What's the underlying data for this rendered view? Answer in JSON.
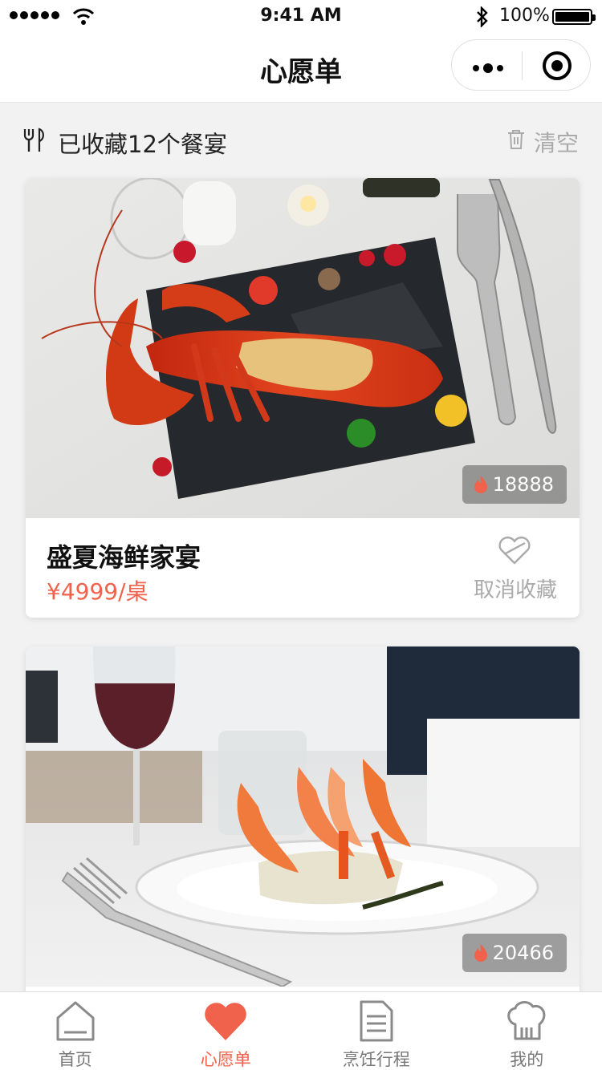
{
  "status_bar": {
    "time": "9:41 AM",
    "battery": "100%"
  },
  "navbar": {
    "title": "心愿单"
  },
  "header": {
    "summary": "已收藏12个餐宴",
    "clear_label": "清空"
  },
  "cards": [
    {
      "title": "盛夏海鲜家宴",
      "price": "¥4999/桌",
      "views": "18888",
      "unfavorite_label": "取消收藏"
    },
    {
      "views": "20466"
    }
  ],
  "tabbar": {
    "items": [
      {
        "label": "首页",
        "icon": "home-icon",
        "active": false
      },
      {
        "label": "心愿单",
        "icon": "heart-icon",
        "active": true
      },
      {
        "label": "烹饪行程",
        "icon": "document-icon",
        "active": false
      },
      {
        "label": "我的",
        "icon": "chef-hat-icon",
        "active": false
      }
    ]
  },
  "colors": {
    "accent": "#f0624b",
    "muted": "#aaaaaa"
  }
}
